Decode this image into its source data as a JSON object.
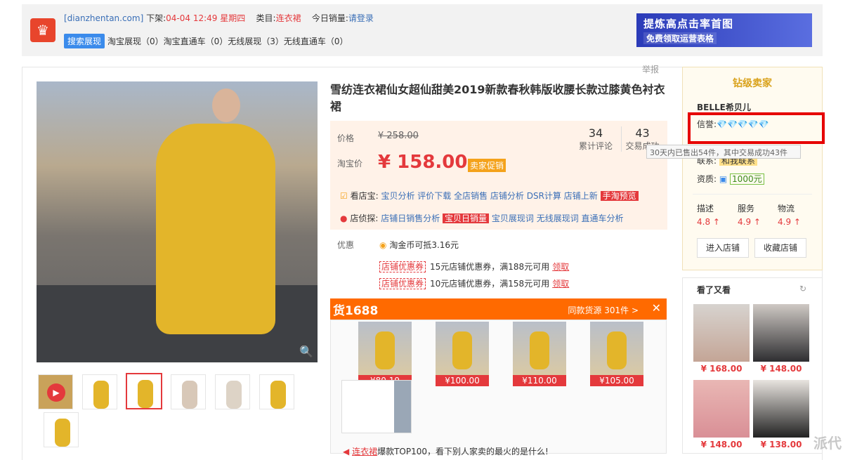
{
  "topbar": {
    "site": "[dianzhentan.com]",
    "shelf_label": "下架:",
    "shelf_time": "04-04 12:49 星期四",
    "cat_label": "类目:",
    "cat_value": "连衣裙",
    "sales_label": "今日销量:",
    "sales_value": "请登录",
    "search_tag": "搜索展现",
    "stats": "淘宝展现（0）淘宝直通车（0）无线展现（3）无线直通车（0）"
  },
  "banner": {
    "line1": "提炼高点击率首图",
    "line2": "免费领取运营表格"
  },
  "report": "举报",
  "product": {
    "title": "雪纺连衣裙仙女超仙甜美2019新款春秋韩版收腰长款过膝黄色衬衣裙",
    "price_label": "价格",
    "orig_price": "¥ 258.00",
    "tb_label": "淘宝价",
    "cur_price": "¥ 158.00",
    "promo": "卖家促销",
    "reviews_n": "34",
    "reviews_l": "累计评论",
    "trades_n": "43",
    "trades_l": "交易成功"
  },
  "tools": {
    "k_label": "看店宝:",
    "k_items": "宝贝分析 评价下载 全店销售 店铺分析 DSR计算 店铺上新",
    "k_hot": "手淘预览",
    "d_label": "店侦探:",
    "d_items1": "店铺日销售分析",
    "d_hot": "宝贝日销量",
    "d_items2": "宝贝展现词 无线展现词 直通车分析"
  },
  "youhui": {
    "label": "优惠",
    "coin": "淘金币可抵3.16元",
    "coupons": [
      {
        "tag": "店铺优惠券",
        "text": "15元店铺优惠券，满188元可用",
        "link": "领取"
      },
      {
        "tag": "店铺优惠券",
        "text": "10元店铺优惠券，满158元可用",
        "link": "领取"
      }
    ]
  },
  "ali1688": {
    "logo": "货1688",
    "same": "同款货源  301件 >",
    "close": "✕",
    "prices": [
      "¥80.19",
      "¥100.00",
      "¥110.00",
      "¥105.00"
    ]
  },
  "bottom": {
    "tag": "连衣裙",
    "text": "爆款TOP100，看下别人家卖的最火的是什么!"
  },
  "seller": {
    "level": "钻级卖家",
    "name": "BELLE希贝儿",
    "credit_label": "信誉:",
    "diamonds": "💎💎💎💎💎",
    "tooltip": "30天内已售出54件，其中交易成功43件",
    "contact_label": "联系:",
    "contact": "和我联系",
    "qual_label": "资质:",
    "deposit": "1000元",
    "scores": [
      {
        "l": "描述",
        "v": "4.8 ↑"
      },
      {
        "l": "服务",
        "v": "4.9 ↑"
      },
      {
        "l": "物流",
        "v": "4.9 ↑"
      }
    ],
    "enter": "进入店铺",
    "fav": "收藏店铺"
  },
  "seeagain": {
    "title": "看了又看",
    "items": [
      "¥ 168.00",
      "¥ 148.00",
      "¥ 148.00",
      "¥ 138.00"
    ]
  },
  "watermark": "派代"
}
